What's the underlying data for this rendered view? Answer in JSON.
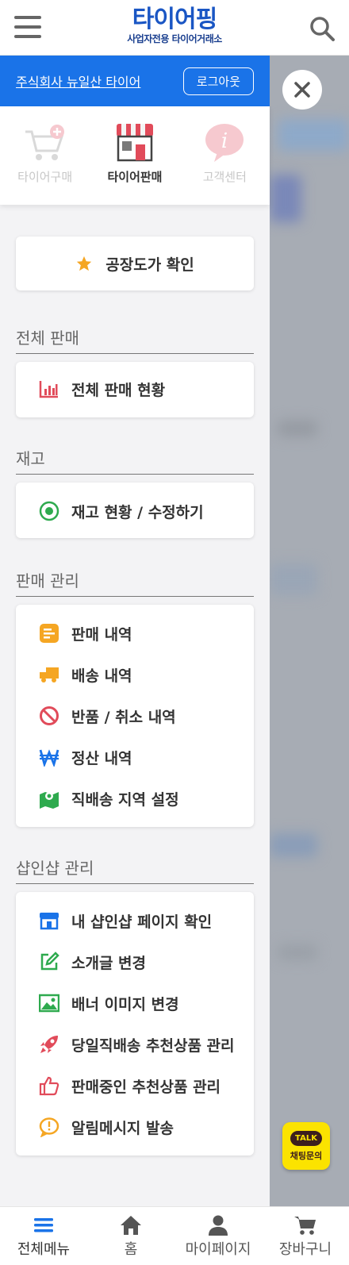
{
  "header": {
    "logo_main": "타이어핑",
    "logo_sub": "사업자전용 타이어거래소"
  },
  "drawer": {
    "store_name": "주식회사 뉴일산 타이어",
    "logout_label": "로그아웃",
    "modes": [
      {
        "label": "타이어구매",
        "active": false
      },
      {
        "label": "타이어판매",
        "active": true
      },
      {
        "label": "고객센터",
        "active": false
      }
    ],
    "factory_price_label": "공장도가 확인",
    "sections": {
      "total_sales": {
        "title": "전체 판매",
        "items": [
          "전체 판매 현황"
        ]
      },
      "stock": {
        "title": "재고",
        "items": [
          "재고 현황 / 수정하기"
        ]
      },
      "sales_mgmt": {
        "title": "판매 관리",
        "items": [
          "판매 내역",
          "배송 내역",
          "반품 / 취소 내역",
          "정산 내역",
          "직배송 지역 설정"
        ]
      },
      "shop_mgmt": {
        "title": "샵인샵 관리",
        "items": [
          "내 샵인샵 페이지 확인",
          "소개글 변경",
          "배너 이미지 변경",
          "당일직배송 추천상품 관리",
          "판매중인 추천상품 관리",
          "알림메시지 발송"
        ]
      }
    }
  },
  "kakao": {
    "bubble": "TALK",
    "label": "채팅문의"
  },
  "bottom_nav": [
    {
      "label": "전체메뉴",
      "icon": "menu-icon"
    },
    {
      "label": "홈",
      "icon": "home-icon"
    },
    {
      "label": "마이페이지",
      "icon": "user-icon"
    },
    {
      "label": "장바구니",
      "icon": "cart-icon"
    }
  ],
  "colors": {
    "brand_blue": "#1a73e8",
    "kakao_yellow": "#fbe300"
  }
}
